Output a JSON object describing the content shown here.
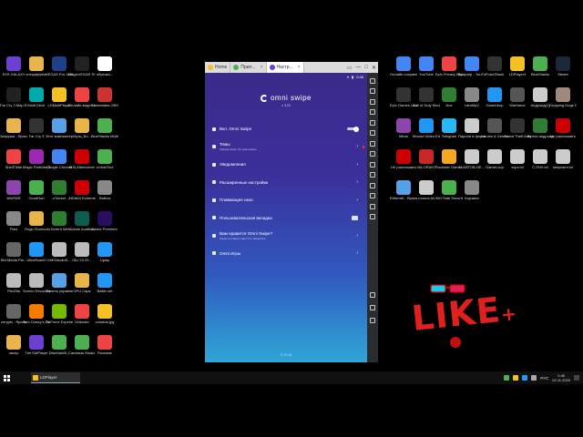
{
  "desktop": {
    "icons_left": [
      {
        "label": "SSS GALAXY",
        "color": "#6b3fd1"
      },
      {
        "label": "спецэффект",
        "color": "#e9b44c"
      },
      {
        "label": "VEGAS Pro 18.0",
        "color": "#1f3f88"
      },
      {
        "label": "MagixVEGAS Pro",
        "color": "#222"
      },
      {
        "label": "обрезка...",
        "color": "#fff"
      },
      {
        "label": "Far Cry 3 Map Editor",
        "color": "#222"
      },
      {
        "label": "Multi Drive",
        "color": "#0aa"
      },
      {
        "label": "LDMultiPlayer",
        "color": "#f5c024"
      },
      {
        "label": "Онлайн-видео кон...",
        "color": "#e44"
      },
      {
        "label": "Streamlabs OBS",
        "color": "#c33"
      },
      {
        "label": "Загрузки - Ярлык",
        "color": "#e9b44c"
      },
      {
        "label": "Far Cry 3",
        "color": "#333"
      },
      {
        "label": "Этот компьютер",
        "color": "#57a0e6"
      },
      {
        "label": "Игры_Бл...",
        "color": "#e9b44c"
      },
      {
        "label": "BlueStacks Multi-Insta...",
        "color": "#4caf50"
      },
      {
        "label": "ShellTikbe",
        "color": "#e44"
      },
      {
        "label": "Magix Particles 3D",
        "color": "#9c27b0"
      },
      {
        "label": "Google Chrome",
        "color": "#4285f4"
      },
      {
        "label": "MSI Afterburner",
        "color": "#c00"
      },
      {
        "label": "UninstTool",
        "color": "#4caf50"
      },
      {
        "label": "WinRAR",
        "color": "#8e44ad"
      },
      {
        "label": "GoodHub",
        "color": "#4caf50"
      },
      {
        "label": "uTorrent",
        "color": "#2e7d32"
      },
      {
        "label": "AIDA64 Extreme",
        "color": "#c00"
      },
      {
        "label": "Файлы",
        "color": "#888"
      },
      {
        "label": "Files",
        "color": "#888"
      },
      {
        "label": "Rogo Shortcut",
        "color": "#e9b44c"
      },
      {
        "label": "uTorrent Web",
        "color": "#2e7d32"
      },
      {
        "label": "Adobe Audition",
        "color": "#0b5d4f"
      },
      {
        "label": "Adobe Premiere P...",
        "color": "#2a0e5e"
      },
      {
        "label": "Bef.Media Pla...",
        "color": "#666"
      },
      {
        "label": "UltraSearch",
        "color": "#2196f3"
      },
      {
        "label": "KMGAudioS...",
        "color": "#bbb"
      },
      {
        "label": "GiLi 23.29...",
        "color": "#bbb"
      },
      {
        "label": "Uplay",
        "color": "#2196f3"
      },
      {
        "label": "FileZilla",
        "color": "#bbb"
      },
      {
        "label": "Screen Recorder",
        "color": "#bbb"
      },
      {
        "label": "Панель управлен...",
        "color": "#57a0e6"
      },
      {
        "label": "GPU Caps",
        "color": "#e9b44c"
      },
      {
        "label": "Battle.net",
        "color": "#2196f3"
      },
      {
        "label": "сетрум - Ярлык",
        "color": "#666"
      },
      {
        "label": "Tom Clancy's The Division",
        "color": "#f57c00"
      },
      {
        "label": "GeForce Experience",
        "color": "#76b900"
      },
      {
        "label": "Videoder",
        "color": "#e44"
      },
      {
        "label": "colorbar.jpg",
        "color": "#f5c024"
      },
      {
        "label": "ляхер",
        "color": "#e9b44c"
      },
      {
        "label": "The KMPlayer",
        "color": "#6b3fd1"
      },
      {
        "label": "DiskMarkB...",
        "color": "#4caf50"
      },
      {
        "label": "Camtasia Studio 8",
        "color": "#4caf50"
      },
      {
        "label": "Rockstar",
        "color": "#e44"
      }
    ],
    "icons_right": [
      {
        "label": "Онлайн сохранен...",
        "color": "#4285f4"
      },
      {
        "label": "YouTube",
        "color": "#4285f4"
      },
      {
        "label": "Epic Privacy Browser",
        "color": "#e44"
      },
      {
        "label": "Браузер - YouTube",
        "color": "#4285f4"
      },
      {
        "label": "Point Blank",
        "color": "#333"
      },
      {
        "label": "LDPlayer4",
        "color": "#f5c024"
      },
      {
        "label": "BlueStacks",
        "color": "#4caf50"
      },
      {
        "label": "Steam",
        "color": "#1b2838"
      },
      {
        "label": "Epic Games Launcher",
        "color": "#333"
      },
      {
        "label": "Call of Duty Modern...",
        "color": "#333"
      },
      {
        "label": "Nox",
        "color": "#2e7d32"
      },
      {
        "label": "IdentityV",
        "color": "#888"
      },
      {
        "label": "Gamedrop",
        "color": "#2196f3"
      },
      {
        "label": "Warframe",
        "color": "#555"
      },
      {
        "label": "Андроид(1)",
        "color": "#ccc"
      },
      {
        "label": "Dropping Doge D...",
        "color": "#a1887f"
      },
      {
        "label": "Miros",
        "color": "#8e44ad"
      },
      {
        "label": "Movavi Video Editor 20 Plus",
        "color": "#2196f3"
      },
      {
        "label": "Telegram",
        "color": "#29b6f6"
      },
      {
        "label": "Пароли и форматы",
        "color": "#ccc"
      },
      {
        "label": "Heroes & Generals",
        "color": "#555"
      },
      {
        "label": "Grand Theft Auto V",
        "color": "#333"
      },
      {
        "label": "Фулла андроид",
        "color": "#2e7d32"
      },
      {
        "label": "Не разглашать",
        "color": "#c00"
      },
      {
        "label": "Не разглашать",
        "color": "#c00"
      },
      {
        "label": "VALORANT",
        "color": "#c62828"
      },
      {
        "label": "Rockstar Games...",
        "color": "#f5a623"
      },
      {
        "label": "С АЙТОВ-НЕ...",
        "color": "#ccc"
      },
      {
        "label": "GameLoop",
        "color": "#ccc"
      },
      {
        "label": "хорз.txt",
        "color": "#ccc"
      },
      {
        "label": "С.ЛЧН.txt",
        "color": "#ccc"
      },
      {
        "label": "неприятн.txt",
        "color": "#ccc"
      },
      {
        "label": "Ethernet - Ярлык",
        "color": "#57a0e6"
      },
      {
        "label": "голоса.txt",
        "color": "#ccc"
      },
      {
        "label": "360 Total Security",
        "color": "#4caf50"
      },
      {
        "label": "Корзина",
        "color": "#888"
      }
    ]
  },
  "like_sticker": {
    "text": "LIKE",
    "plus": "+"
  },
  "emulator": {
    "tabs": [
      {
        "label": "Home",
        "color": "#f5c024"
      },
      {
        "label": "Прил...",
        "color": "#4caf50"
      },
      {
        "label": "Настр...",
        "color": "#6b3fd1"
      }
    ],
    "window_controls": [
      "▭",
      "—",
      "□",
      "✕"
    ],
    "status_time": "0:46",
    "app": {
      "logo_text": "omni swipe",
      "version": "v 3.15",
      "menu": [
        {
          "title": "Вкл. Omni Swipe",
          "subtitle": "",
          "control": "toggle"
        },
        {
          "title": "Темы",
          "subtitle": "Оформление. По умолчанию",
          "control": "chevron-dot"
        },
        {
          "title": "Уведомления",
          "subtitle": "",
          "control": "chevron"
        },
        {
          "title": "Расширенные настройки",
          "subtitle": "",
          "control": "chevron"
        },
        {
          "title": "Плавающее окно",
          "subtitle": "",
          "control": "chevron"
        },
        {
          "title": "Пользовательская вкладка",
          "subtitle": "",
          "control": "square"
        },
        {
          "title": "Вам нравится Omni Swipe?",
          "subtitle": "Когда поставьте нам пять звёздочек",
          "control": "chevron"
        },
        {
          "title": "Omni Игры",
          "subtitle": "",
          "control": "chevron"
        }
      ],
      "footer": "© 10.18"
    }
  },
  "taskbar": {
    "task_label": "LDPlayer",
    "tray_lang": "РУС",
    "time": "0:46",
    "date": "02.11.2020"
  }
}
